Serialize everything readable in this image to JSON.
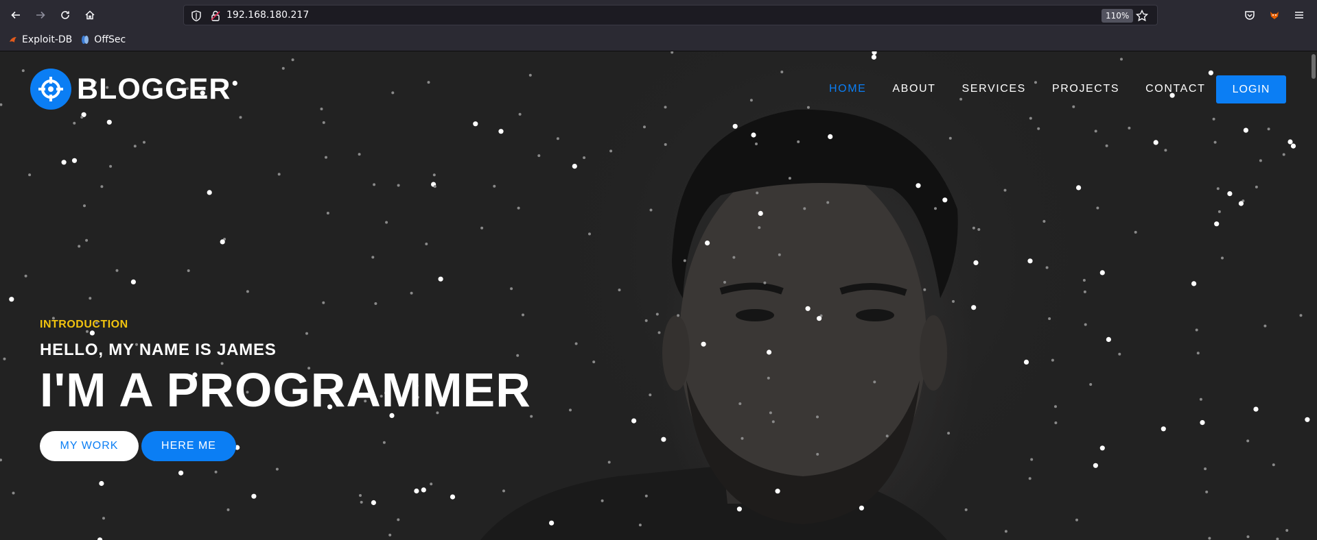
{
  "browser": {
    "url": "192.168.180.217",
    "zoom": "110%",
    "bookmarks": [
      {
        "label": "Exploit-DB",
        "icon": "exploit-db-icon"
      },
      {
        "label": "OffSec",
        "icon": "offsec-icon"
      }
    ]
  },
  "site": {
    "logo_text": "BLOGGER",
    "nav": [
      {
        "label": "HOME",
        "active": true
      },
      {
        "label": "ABOUT",
        "active": false
      },
      {
        "label": "SERVICES",
        "active": false
      },
      {
        "label": "PROJECTS",
        "active": false
      },
      {
        "label": "CONTACT",
        "active": false
      }
    ],
    "login_label": "LOGIN",
    "hero": {
      "intro": "INTRODUCTION",
      "hello": "HELLO, MY NAME IS JAMES",
      "headline": "I'M A PROGRAMMER",
      "primary_button": "MY WORK",
      "secondary_button": "HERE ME"
    },
    "colors": {
      "accent": "#0b7ef4",
      "intro": "#f2c40f",
      "background": "#222222"
    }
  }
}
